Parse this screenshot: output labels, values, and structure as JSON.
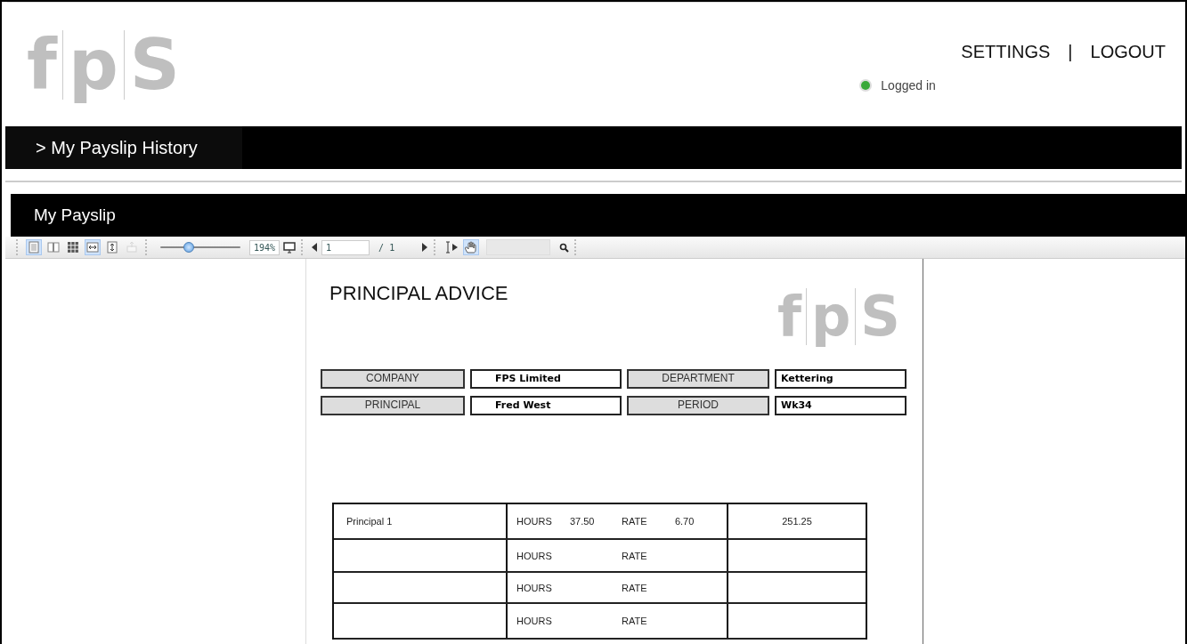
{
  "logo": {
    "letters": [
      "f",
      "p",
      "S"
    ]
  },
  "nav": [
    {
      "label": "SETTINGS"
    },
    {
      "label": "LOGOUT"
    }
  ],
  "nav_separator": "|",
  "status": {
    "label": "Logged in"
  },
  "breadcrumb": "> My Payslip History",
  "panel": {
    "title": "My Payslip"
  },
  "toolbar": {
    "view_buttons": [
      {
        "kind": "single",
        "selected": true,
        "disabled": false
      },
      {
        "kind": "double",
        "selected": false,
        "disabled": false
      },
      {
        "kind": "grid",
        "selected": false,
        "disabled": false
      },
      {
        "kind": "fit_width",
        "selected": true,
        "disabled": false
      },
      {
        "kind": "fit_height",
        "selected": false,
        "disabled": false
      },
      {
        "kind": "print",
        "selected": false,
        "disabled": true
      }
    ],
    "zoom": {
      "level": 0.35,
      "reading": "194%"
    },
    "page": {
      "value": "1",
      "total": "/ 1"
    },
    "tools": [
      {
        "kind": "select",
        "selected": false
      },
      {
        "kind": "hand",
        "selected": true
      }
    ]
  },
  "document": {
    "title": "PRINCIPAL ADVICE",
    "logo": {
      "letters": [
        "f",
        "p",
        "S"
      ]
    },
    "fields": [
      {
        "label": "COMPANY",
        "value": "FPS Limited"
      },
      {
        "label": "DEPARTMENT",
        "value": "Kettering"
      },
      {
        "label": "PRINCIPAL",
        "value": "Fred West"
      },
      {
        "label": "PERIOD",
        "value": "Wk34"
      }
    ],
    "rows": [
      {
        "name": "Principal 1",
        "hours_label": "HOURS",
        "hours": "37.50",
        "rate_label": "RATE",
        "rate": "6.70",
        "amount": "251.25"
      },
      {
        "hours_label": "HOURS",
        "rate_label": "RATE"
      },
      {
        "hours_label": "HOURS",
        "rate_label": "RATE"
      },
      {
        "hours_label": "HOURS",
        "rate_label": "RATE"
      }
    ]
  }
}
